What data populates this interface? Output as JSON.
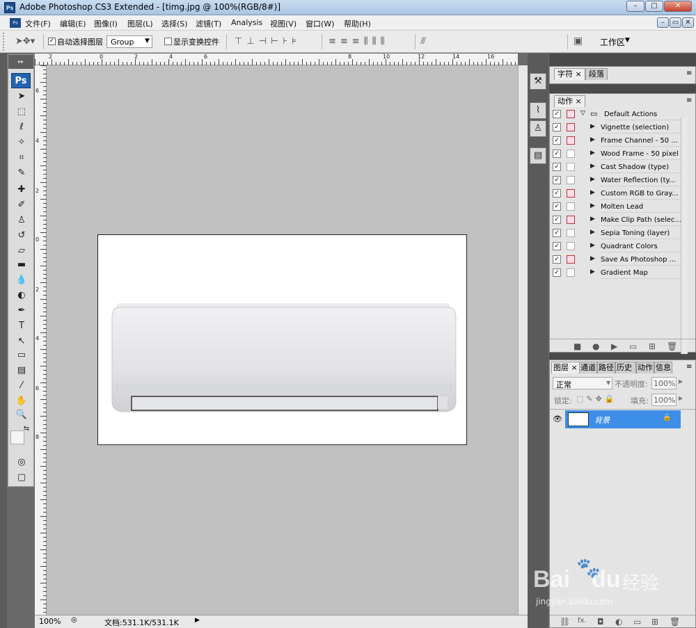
{
  "app": {
    "title": "Adobe Photoshop CS3 Extended - [timg.jpg @ 100%(RGB/8#)]",
    "logo": "Ps"
  },
  "window_buttons": {
    "minimize": "–",
    "restore": "□",
    "close": "✕"
  },
  "doc_buttons": {
    "minimize": "–",
    "restore": "▭",
    "close": "✕"
  },
  "menu": [
    "文件(F)",
    "编辑(E)",
    "图像(I)",
    "图层(L)",
    "选择(S)",
    "滤镜(T)",
    "Analysis",
    "视图(V)",
    "窗口(W)",
    "帮助(H)"
  ],
  "options": {
    "auto_select_label": "自动选择图层",
    "auto_select_checked": true,
    "group_value": "Group",
    "show_transform_label": "显示变换控件",
    "show_transform_checked": false,
    "workspace_label": "工作区"
  },
  "ruler_top": [
    "2",
    "0",
    "2",
    "4",
    "6",
    "8",
    "10",
    "12",
    "14",
    "16"
  ],
  "ruler_left": [
    "6",
    "4",
    "2",
    "0",
    "2",
    "4",
    "6",
    "8"
  ],
  "toolbox": {
    "head": "▸▸",
    "logo": "Ps",
    "tools": [
      {
        "name": "move-tool-icon",
        "glyph": "➤"
      },
      {
        "name": "marquee-tool-icon",
        "glyph": "⬚"
      },
      {
        "name": "lasso-tool-icon",
        "glyph": "ℓ"
      },
      {
        "name": "magic-wand-icon",
        "glyph": "✧"
      },
      {
        "name": "crop-tool-icon",
        "glyph": "⌗"
      },
      {
        "name": "slice-tool-icon",
        "glyph": "✎"
      },
      {
        "name": "healing-brush-icon",
        "glyph": "✚"
      },
      {
        "name": "brush-tool-icon",
        "glyph": "✐"
      },
      {
        "name": "clone-stamp-icon",
        "glyph": "♙"
      },
      {
        "name": "history-brush-icon",
        "glyph": "↺"
      },
      {
        "name": "eraser-tool-icon",
        "glyph": "▱"
      },
      {
        "name": "gradient-tool-icon",
        "glyph": "▬"
      },
      {
        "name": "blur-tool-icon",
        "glyph": "💧"
      },
      {
        "name": "dodge-tool-icon",
        "glyph": "◐"
      },
      {
        "name": "pen-tool-icon",
        "glyph": "✒"
      },
      {
        "name": "type-tool-icon",
        "glyph": "T"
      },
      {
        "name": "path-select-icon",
        "glyph": "↖"
      },
      {
        "name": "shape-tool-icon",
        "glyph": "▭"
      },
      {
        "name": "notes-tool-icon",
        "glyph": "▤"
      },
      {
        "name": "eyedropper-icon",
        "glyph": "⁄"
      },
      {
        "name": "hand-tool-icon",
        "glyph": "✋"
      },
      {
        "name": "zoom-tool-icon",
        "glyph": "🔍"
      },
      {
        "name": "color-swap-icon",
        "glyph": "⇆"
      },
      {
        "name": "quick-mask-icon",
        "glyph": "◎"
      },
      {
        "name": "screen-mode-icon",
        "glyph": "▢"
      }
    ]
  },
  "status": {
    "zoom": "100%",
    "doc_info": "文档:531.1K/531.1K",
    "arrow": "▶"
  },
  "char_panel": {
    "tabs": [
      "字符",
      "段落"
    ]
  },
  "actions_panel": {
    "tab": "动作",
    "set": "Default Actions",
    "items": [
      {
        "name": "Vignette (selection)",
        "dialog": true
      },
      {
        "name": "Frame Channel - 50 ...",
        "dialog": true
      },
      {
        "name": "Wood Frame - 50 pixel",
        "dialog": false
      },
      {
        "name": "Cast Shadow (type)",
        "dialog": false
      },
      {
        "name": "Water Reflection (ty...",
        "dialog": false
      },
      {
        "name": "Custom RGB to Gray...",
        "dialog": true
      },
      {
        "name": "Molten Lead",
        "dialog": false
      },
      {
        "name": "Make Clip Path (selec...",
        "dialog": true
      },
      {
        "name": "Sepia Toning (layer)",
        "dialog": false
      },
      {
        "name": "Quadrant Colors",
        "dialog": false
      },
      {
        "name": "Save As Photoshop ...",
        "dialog": true
      },
      {
        "name": "Gradient Map",
        "dialog": false
      }
    ],
    "footer": [
      "■",
      "●",
      "▶",
      "▭",
      "⊞",
      "🗑"
    ]
  },
  "layers_panel": {
    "tabs": [
      "图层",
      "通道",
      "路径",
      "历史记录",
      "动作",
      "信息"
    ],
    "blend_mode": "正常",
    "opacity_label": "不透明度:",
    "opacity": "100%",
    "lock_label": "锁定:",
    "fill_label": "填充:",
    "fill": "100%",
    "layer_name": "背景",
    "footer": [
      "⛓",
      "fx.",
      "◘",
      "◐",
      "▭",
      "⊞",
      "🗑"
    ]
  },
  "watermark": {
    "brand": "Bai",
    "brand2": "du",
    "brand3": "经验",
    "url": "jingyan.baidu.com"
  }
}
